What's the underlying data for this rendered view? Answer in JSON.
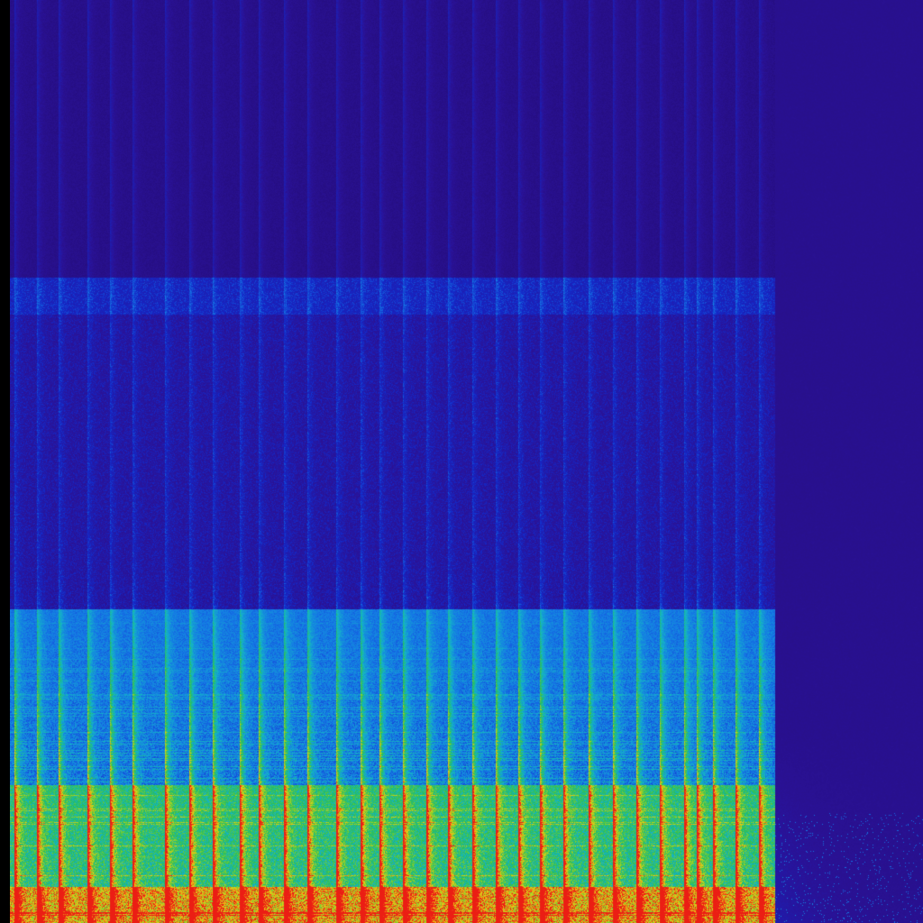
{
  "chart_data": {
    "type": "heatmap",
    "subtype": "spectrogram",
    "title": "",
    "xlabel": "",
    "ylabel": "",
    "colormap": "jet",
    "colors": {
      "background": "#2a118f",
      "axis_gutter": "#000000"
    },
    "grid": false,
    "legend": "none",
    "x_range_fraction": [
      0,
      1
    ],
    "active_extent_fraction": 0.838,
    "tail_extent_fraction": 1.0,
    "beat_count": 33,
    "beat_positions_fraction": [
      0.005,
      0.03,
      0.053,
      0.085,
      0.11,
      0.134,
      0.17,
      0.196,
      0.222,
      0.252,
      0.272,
      0.3,
      0.326,
      0.357,
      0.384,
      0.405,
      0.43,
      0.456,
      0.48,
      0.506,
      0.532,
      0.557,
      0.58,
      0.606,
      0.634,
      0.66,
      0.686,
      0.712,
      0.738,
      0.752,
      0.77,
      0.795,
      0.82
    ],
    "energy_bands": [
      {
        "name": "top-noise",
        "y_from": 0.0,
        "y_to": 0.3,
        "level": 0.03
      },
      {
        "name": "upper-harmonics",
        "y_from": 0.3,
        "y_to": 0.34,
        "level": 0.18
      },
      {
        "name": "mid-sparse",
        "y_from": 0.34,
        "y_to": 0.66,
        "level": 0.1
      },
      {
        "name": "low-mid",
        "y_from": 0.66,
        "y_to": 0.85,
        "level": 0.38
      },
      {
        "name": "bass",
        "y_from": 0.85,
        "y_to": 0.96,
        "level": 0.62
      },
      {
        "name": "sub-bass",
        "y_from": 0.96,
        "y_to": 1.0,
        "level": 0.88
      }
    ]
  }
}
